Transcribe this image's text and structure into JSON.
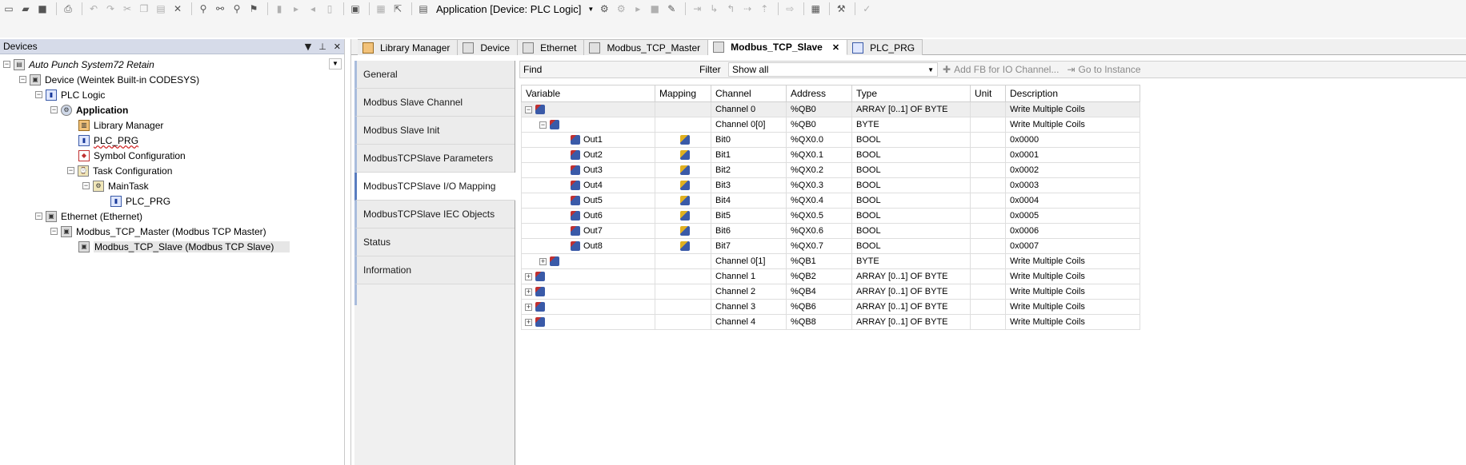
{
  "toolbar": {
    "application_selector": "Application [Device: PLC Logic]"
  },
  "devices_panel": {
    "title": "Devices",
    "tree": [
      {
        "label": "Auto Punch System72 Retain",
        "indent": 0
      },
      {
        "label": "Device (Weintek Built-in CODESYS)",
        "indent": 1
      },
      {
        "label": "PLC Logic",
        "indent": 2
      },
      {
        "label": "Application",
        "indent": 3
      },
      {
        "label": "Library Manager",
        "indent": 4
      },
      {
        "label": "PLC_PRG",
        "indent": 4
      },
      {
        "label": "Symbol Configuration",
        "indent": 4
      },
      {
        "label": "Task Configuration",
        "indent": 4
      },
      {
        "label": "MainTask",
        "indent": 5
      },
      {
        "label": "PLC_PRG",
        "indent": 6
      },
      {
        "label": "Ethernet (Ethernet)",
        "indent": 2
      },
      {
        "label": "Modbus_TCP_Master (Modbus TCP Master)",
        "indent": 3
      },
      {
        "label": "Modbus_TCP_Slave (Modbus TCP Slave)",
        "indent": 4
      }
    ]
  },
  "editor": {
    "tabs": [
      {
        "label": "Library Manager"
      },
      {
        "label": "Device"
      },
      {
        "label": "Ethernet"
      },
      {
        "label": "Modbus_TCP_Master"
      },
      {
        "label": "Modbus_TCP_Slave",
        "active": true
      },
      {
        "label": "PLC_PRG"
      }
    ],
    "pages": [
      "General",
      "Modbus Slave Channel",
      "Modbus Slave Init",
      "ModbusTCPSlave Parameters",
      "ModbusTCPSlave I/O Mapping",
      "ModbusTCPSlave IEC Objects",
      "Status",
      "Information"
    ],
    "active_page": "ModbusTCPSlave I/O Mapping",
    "find_label": "Find",
    "filter_label": "Filter",
    "filter_value": "Show all",
    "add_fb_label": "Add FB for IO Channel...",
    "goto_label": "Go to Instance",
    "columns": [
      "Variable",
      "Mapping",
      "Channel",
      "Address",
      "Type",
      "Unit",
      "Description"
    ],
    "rows": [
      {
        "variable": "",
        "mapping": "",
        "channel": "Channel 0",
        "address": "%QB0",
        "type": "ARRAY [0..1] OF BYTE",
        "unit": "",
        "description": "Write Multiple Coils"
      },
      {
        "variable": "",
        "mapping": "",
        "channel": "Channel 0[0]",
        "address": "%QB0",
        "type": "BYTE",
        "unit": "",
        "description": "Write Multiple Coils"
      },
      {
        "variable": "Out1",
        "mapping": "mapped",
        "channel": "Bit0",
        "address": "%QX0.0",
        "type": "BOOL",
        "unit": "",
        "description": "0x0000"
      },
      {
        "variable": "Out2",
        "mapping": "mapped",
        "channel": "Bit1",
        "address": "%QX0.1",
        "type": "BOOL",
        "unit": "",
        "description": "0x0001"
      },
      {
        "variable": "Out3",
        "mapping": "mapped",
        "channel": "Bit2",
        "address": "%QX0.2",
        "type": "BOOL",
        "unit": "",
        "description": "0x0002"
      },
      {
        "variable": "Out4",
        "mapping": "mapped",
        "channel": "Bit3",
        "address": "%QX0.3",
        "type": "BOOL",
        "unit": "",
        "description": "0x0003"
      },
      {
        "variable": "Out5",
        "mapping": "mapped",
        "channel": "Bit4",
        "address": "%QX0.4",
        "type": "BOOL",
        "unit": "",
        "description": "0x0004"
      },
      {
        "variable": "Out6",
        "mapping": "mapped",
        "channel": "Bit5",
        "address": "%QX0.5",
        "type": "BOOL",
        "unit": "",
        "description": "0x0005"
      },
      {
        "variable": "Out7",
        "mapping": "mapped",
        "channel": "Bit6",
        "address": "%QX0.6",
        "type": "BOOL",
        "unit": "",
        "description": "0x0006"
      },
      {
        "variable": "Out8",
        "mapping": "mapped",
        "channel": "Bit7",
        "address": "%QX0.7",
        "type": "BOOL",
        "unit": "",
        "description": "0x0007"
      },
      {
        "variable": "",
        "mapping": "",
        "channel": "Channel 0[1]",
        "address": "%QB1",
        "type": "BYTE",
        "unit": "",
        "description": "Write Multiple Coils"
      },
      {
        "variable": "",
        "mapping": "",
        "channel": "Channel 1",
        "address": "%QB2",
        "type": "ARRAY [0..1] OF BYTE",
        "unit": "",
        "description": "Write Multiple Coils"
      },
      {
        "variable": "",
        "mapping": "",
        "channel": "Channel 2",
        "address": "%QB4",
        "type": "ARRAY [0..1] OF BYTE",
        "unit": "",
        "description": "Write Multiple Coils"
      },
      {
        "variable": "",
        "mapping": "",
        "channel": "Channel 3",
        "address": "%QB6",
        "type": "ARRAY [0..1] OF BYTE",
        "unit": "",
        "description": "Write Multiple Coils"
      },
      {
        "variable": "",
        "mapping": "",
        "channel": "Channel 4",
        "address": "%QB8",
        "type": "ARRAY [0..1] OF BYTE",
        "unit": "",
        "description": "Write Multiple Coils"
      }
    ]
  }
}
